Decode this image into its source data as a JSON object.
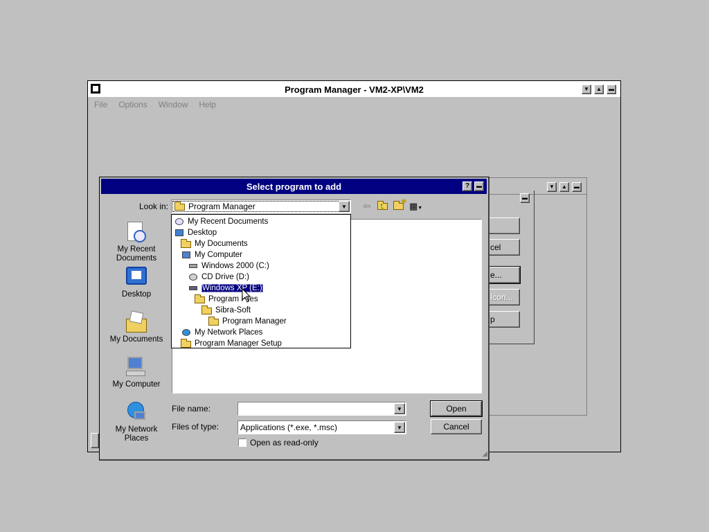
{
  "program_manager": {
    "title": "Program Manager - VM2-XP\\VM2",
    "menu": [
      "File",
      "Options",
      "Window",
      "Help"
    ],
    "controls": {
      "minimize": "▼",
      "maximize": "▲",
      "restore": "▬"
    }
  },
  "child_window": {
    "buttons": [
      "",
      "cel",
      "e...",
      "Icon...",
      "p"
    ]
  },
  "dialog": {
    "title": "Select program to add",
    "help_glyph": "?",
    "look_in_label": "Look in:",
    "look_in_value": "Program Manager",
    "places": [
      "My Recent Documents",
      "Desktop",
      "My Documents",
      "My Computer",
      "My Network Places"
    ],
    "dropdown_items": [
      {
        "label": "My Recent Documents",
        "indent": 0,
        "icon": "recent-documents-icon"
      },
      {
        "label": "Desktop",
        "indent": 0,
        "icon": "desktop-icon"
      },
      {
        "label": "My Documents",
        "indent": 1,
        "icon": "my-documents-icon"
      },
      {
        "label": "My Computer",
        "indent": 1,
        "icon": "my-computer-icon"
      },
      {
        "label": "Windows 2000 (C:)",
        "indent": 2,
        "icon": "hard-drive-icon"
      },
      {
        "label": "CD Drive (D:)",
        "indent": 2,
        "icon": "cd-drive-icon"
      },
      {
        "label": "Windows XP (E:)",
        "indent": 2,
        "icon": "removable-drive-icon",
        "selected": true
      },
      {
        "label": "Program Files",
        "indent": 3,
        "icon": "folder-icon"
      },
      {
        "label": "Sibra-Soft",
        "indent": 4,
        "icon": "folder-icon"
      },
      {
        "label": "Program Manager",
        "indent": 5,
        "icon": "folder-icon"
      },
      {
        "label": "My Network Places",
        "indent": 1,
        "icon": "network-places-icon"
      },
      {
        "label": "Program Manager Setup",
        "indent": 1,
        "icon": "folder-icon"
      }
    ],
    "file_name_label": "File name:",
    "file_name_value": "",
    "files_of_type_label": "Files of type:",
    "files_of_type_value": "Applications (*.exe, *.msc)",
    "read_only_label": "Open as read-only",
    "read_only_checked": false,
    "open_label": "Open",
    "cancel_label": "Cancel"
  }
}
